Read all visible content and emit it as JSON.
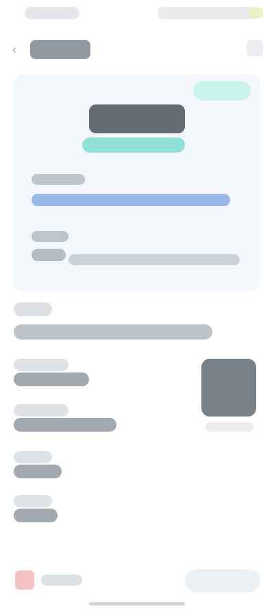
{
  "status_bar": {
    "time": "",
    "icons": [
      "signal-icon",
      "wifi-icon",
      "battery-icon"
    ]
  },
  "header": {
    "title": "",
    "icons": [
      "back-arrow-icon",
      "menu-icon"
    ]
  },
  "ticket_card": {
    "status_badge": "",
    "code": "",
    "route": "",
    "fields": [
      {
        "label": "",
        "value": ""
      },
      {
        "label": "",
        "value": ""
      }
    ],
    "colors": {
      "card_background": "#f3f6fa",
      "accent": "#8fe0d6",
      "badge": "#c9f2ec",
      "link": "#8fb4e6"
    }
  },
  "details": {
    "section_label": "",
    "summary": "",
    "rows": [
      {
        "label": "",
        "value": ""
      },
      {
        "label": "",
        "value": ""
      },
      {
        "label": "",
        "value": ""
      },
      {
        "label": "",
        "value": ""
      }
    ],
    "qr_caption": ""
  },
  "bottom_bar": {
    "cancel_label": "",
    "primary_label": "",
    "icons": [
      "cancel-icon"
    ],
    "colors": {
      "danger": "#f3b3b3"
    }
  }
}
